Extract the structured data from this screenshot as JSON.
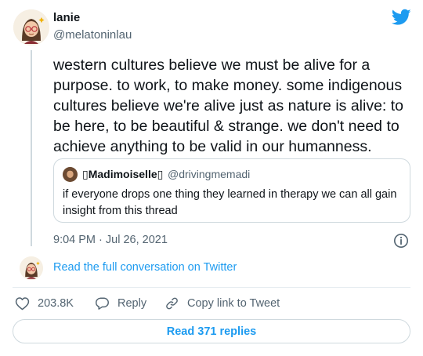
{
  "author": {
    "display_name": "lanie",
    "handle": "@melatoninlau",
    "avatar_icon": "cartoon-avatar-glasses"
  },
  "tweet": {
    "text": "western cultures believe we must be alive for a purpose. to work, to make money. some indigenous cultures believe we're alive just as nature is alive: to be here, to be beautiful & strange. we don't need to achieve anything to be valid in our humanness.",
    "timestamp": "9:04 PM · Jul 26, 2021"
  },
  "quote": {
    "display_name": "▯Madimoiselle▯",
    "handle": "@drivingmemadi",
    "text": "if everyone drops one thing they learned in therapy we can all gain insight from this thread"
  },
  "conversation_link": "Read the full conversation on Twitter",
  "actions": {
    "like_count": "203.8K",
    "reply_label": "Reply",
    "copy_label": "Copy link to Tweet"
  },
  "read_replies_label": "Read 371 replies",
  "colors": {
    "accent": "#1d9bf0",
    "text": "#0f1419",
    "muted": "#536471",
    "border": "#cfd9de"
  },
  "icons": {
    "brand": "twitter-bird-icon",
    "info": "info-icon",
    "like": "heart-icon",
    "reply": "speech-bubble-icon",
    "copy": "link-icon"
  }
}
